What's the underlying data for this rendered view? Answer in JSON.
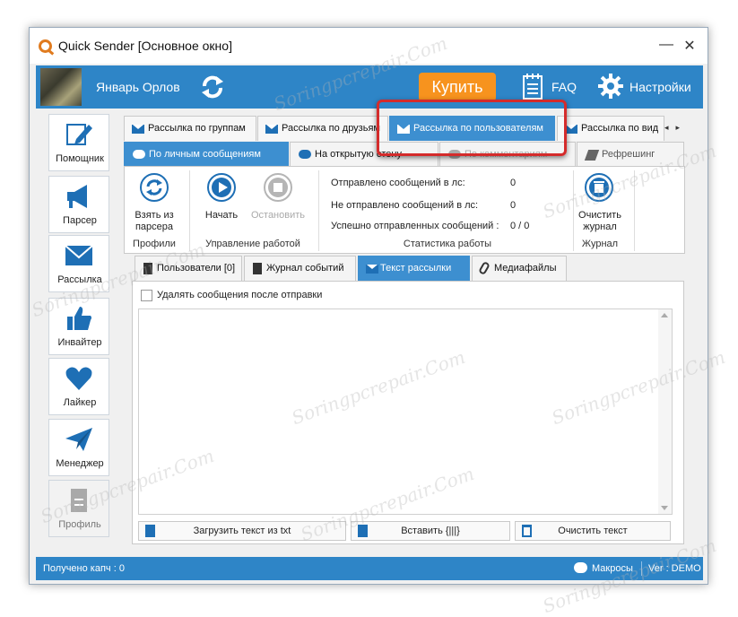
{
  "window": {
    "title": "Quick Sender [Основное окно]",
    "minimize": "—",
    "close": "✕"
  },
  "header": {
    "user_name": "Январь Орлов",
    "buy_label": "Купить",
    "faq_label": "FAQ",
    "settings_label": "Настройки",
    "accent": "#2e85c7",
    "buy_color": "#f7931e"
  },
  "sidebar": {
    "items": [
      {
        "label": "Помощник",
        "icon": "pencil-icon"
      },
      {
        "label": "Парсер",
        "icon": "megaphone-icon"
      },
      {
        "label": "Рассылка",
        "icon": "envelope-icon"
      },
      {
        "label": "Инвайтер",
        "icon": "thumbs-up-icon"
      },
      {
        "label": "Лайкер",
        "icon": "heart-icon"
      },
      {
        "label": "Менеджер",
        "icon": "paper-plane-icon"
      },
      {
        "label": "Профиль",
        "icon": "document-icon"
      }
    ]
  },
  "tabs_top": [
    {
      "label": "Рассылка по группам"
    },
    {
      "label": "Рассылка по друзьям"
    },
    {
      "label": "Рассылка по пользователям"
    },
    {
      "label": "Рассылка по вид"
    }
  ],
  "tabs_second": [
    {
      "label": "По личным сообщениям"
    },
    {
      "label": "На открытую стену"
    },
    {
      "label": "По комментариям"
    },
    {
      "label": "Рефрешинг"
    }
  ],
  "ribbon": {
    "profiles": {
      "button": "Взять из парсера",
      "group": "Профили"
    },
    "work": {
      "start": "Начать",
      "stop": "Остановить",
      "group": "Управление работой"
    },
    "stats": {
      "group": "Статистика работы",
      "rows": [
        {
          "label": "Отправлено сообщений в лс:",
          "value": "0"
        },
        {
          "label": "Не отправлено сообщений в лс:",
          "value": "0"
        },
        {
          "label": "Успешно отправленных сообщений :",
          "value": "0 / 0"
        }
      ]
    },
    "journal": {
      "button": "Очистить журнал",
      "group": "Журнал"
    }
  },
  "tabs_third": [
    {
      "label": "Пользователи [0]"
    },
    {
      "label": "Журнал событий"
    },
    {
      "label": "Текст рассылки"
    },
    {
      "label": "Медиафайлы"
    }
  ],
  "content": {
    "delete_after_send": "Удалять сообщения после отправки",
    "message_text": "",
    "load_txt": "Загрузить текст из txt",
    "insert": "Вставить {|||}",
    "clear_text": "Очистить текст"
  },
  "statusbar": {
    "captcha": "Получено капч :   0",
    "macros": "Макросы",
    "version": "Ver : DEMO"
  },
  "watermark": "Soringpcrepair.Com"
}
